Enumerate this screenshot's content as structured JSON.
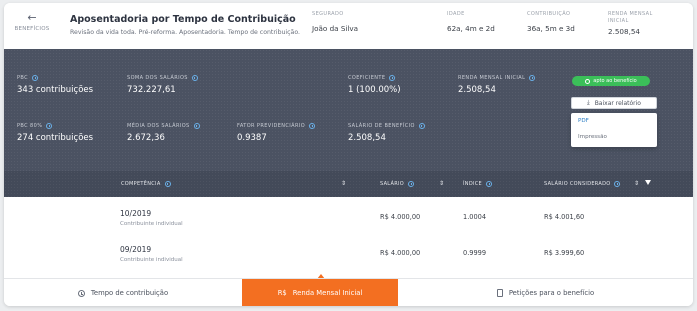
{
  "header": {
    "back_label": "BENEFÍCIOS",
    "title": "Aposentadoria por Tempo de Contribuição",
    "subtitle": "Revisão da vida toda. Pré-reforma. Aposentadoria. Tempo de contribuição.",
    "cols": [
      {
        "key": "SEGURADO",
        "value": "João da Silva"
      },
      {
        "key": "IDADE",
        "value": "62a, 4m e 2d"
      },
      {
        "key": "CONTRIBUIÇÃO",
        "value": "36a, 5m e 3d"
      },
      {
        "key": "RENDA MENSAL INICIAL",
        "value": "2.508,54"
      }
    ]
  },
  "summary": {
    "row1": [
      {
        "key": "PBC",
        "value": "343 contribuições"
      },
      {
        "key": "SOMA DOS SALÁRIOS",
        "value": "732.227,61"
      },
      {
        "key": "COEFICIENTE",
        "value": "1 (100.00%)"
      },
      {
        "key": "RENDA MENSAL INICIAL",
        "value": "2.508,54"
      }
    ],
    "row2": [
      {
        "key": "PBC 80%",
        "value": "274 contribuições"
      },
      {
        "key": "MÉDIA DOS SALÁRIOS",
        "value": "2.672,36"
      },
      {
        "key": "FATOR PREVIDENCIÁRIO",
        "value": "0.9387"
      },
      {
        "key": "SALÁRIO DE BENEFÍCIO",
        "value": "2.508,54"
      }
    ],
    "badge": "apto ao benefício",
    "download_label": "Baixar relatório",
    "download_options": [
      "PDF",
      "Impressão"
    ]
  },
  "table": {
    "headers": [
      "COMPETÊNCIA",
      "SALÁRIO",
      "ÍNDICE",
      "SALÁRIO CONSIDERADO"
    ],
    "rows": [
      {
        "competencia": "10/2019",
        "tipo": "Contribuinte individual",
        "salario": "R$ 4.000,00",
        "indice": "1.0004",
        "considerado": "R$ 4.001,60"
      },
      {
        "competencia": "09/2019",
        "tipo": "Contribuinte individual",
        "salario": "R$ 4.000,00",
        "indice": "0.9999",
        "considerado": "R$ 3.999,60"
      }
    ]
  },
  "tabs": [
    {
      "label": "Tempo de contribuição",
      "icon": "clock-icon"
    },
    {
      "label": "Renda Mensal Inicial",
      "icon": "currency-icon",
      "prefix": "R$"
    },
    {
      "label": "Petições para o benefício",
      "icon": "document-icon"
    }
  ],
  "colors": {
    "accent": "#f36f21",
    "dark": "#4b5262",
    "success": "#3bbf59",
    "info": "#6ab0e8"
  }
}
